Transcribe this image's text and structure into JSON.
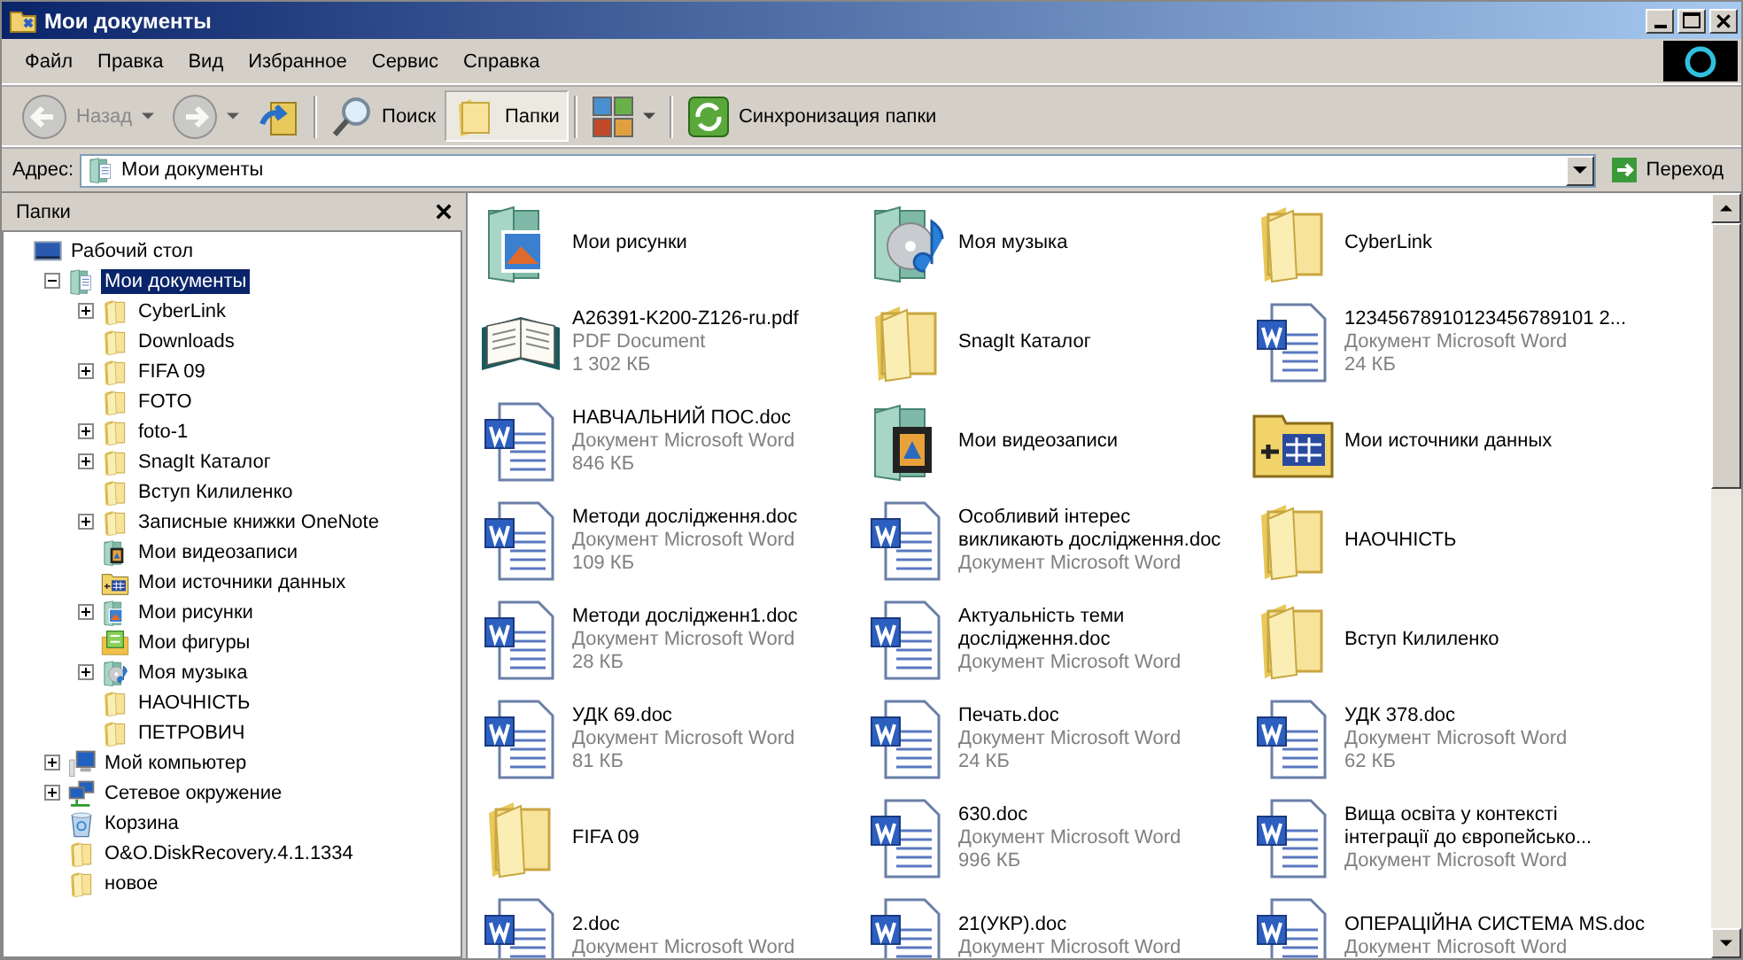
{
  "window": {
    "title": "Мои документы"
  },
  "menu": [
    "Файл",
    "Правка",
    "Вид",
    "Избранное",
    "Сервис",
    "Справка"
  ],
  "toolbar": [
    {
      "kind": "back",
      "label": "Назад",
      "disabled": true,
      "dropdown": true,
      "selected": false
    },
    {
      "kind": "forward",
      "disabled": true,
      "dropdown": true,
      "selected": false
    },
    {
      "kind": "up",
      "disabled": false,
      "dropdown": false,
      "selected": false
    },
    {
      "kind": "separator"
    },
    {
      "kind": "search",
      "label": "Поиск",
      "disabled": false,
      "dropdown": false,
      "selected": false
    },
    {
      "kind": "folders",
      "label": "Папки",
      "disabled": false,
      "dropdown": false,
      "selected": true
    },
    {
      "kind": "separator"
    },
    {
      "kind": "views",
      "disabled": false,
      "dropdown": true,
      "selected": false
    },
    {
      "kind": "separator"
    },
    {
      "kind": "sync",
      "label": "Синхронизация папки",
      "disabled": false,
      "dropdown": false,
      "selected": false
    }
  ],
  "address": {
    "label": "Адрес:",
    "value": "Мои документы",
    "go": "Переход"
  },
  "folders_pane": {
    "title": "Папки",
    "tree": [
      {
        "label": "Рабочий стол",
        "kind": "desktop",
        "selected": false,
        "children": [
          {
            "label": "Мои документы",
            "kind": "documents",
            "expanded": true,
            "selected": true,
            "children": [
              {
                "label": "CyberLink",
                "kind": "folder",
                "expanded": false,
                "selected": false
              },
              {
                "label": "Downloads",
                "kind": "folder",
                "selected": false
              },
              {
                "label": "FIFA 09",
                "kind": "folder",
                "expanded": false,
                "selected": false
              },
              {
                "label": "FOTO",
                "kind": "folder",
                "selected": false
              },
              {
                "label": "foto-1",
                "kind": "folder",
                "expanded": false,
                "selected": false
              },
              {
                "label": "SnagIt Каталог",
                "kind": "folder",
                "expanded": false,
                "selected": false
              },
              {
                "label": "Вступ Килиленко",
                "kind": "folder",
                "selected": false
              },
              {
                "label": "Записные книжки OneNote",
                "kind": "folder",
                "expanded": false,
                "selected": false
              },
              {
                "label": "Мои видеозаписи",
                "kind": "video",
                "selected": false
              },
              {
                "label": "Мои источники данных",
                "kind": "datasource",
                "selected": false
              },
              {
                "label": "Мои рисунки",
                "kind": "pictures",
                "expanded": false,
                "selected": false
              },
              {
                "label": "Мои фигуры",
                "kind": "shapes",
                "selected": false
              },
              {
                "label": "Моя музыка",
                "kind": "music",
                "expanded": false,
                "selected": false
              },
              {
                "label": "НАОЧНІСТЬ",
                "kind": "folder",
                "selected": false
              },
              {
                "label": "ПЕТРОВИЧ",
                "kind": "folder",
                "selected": false
              }
            ]
          },
          {
            "label": "Мой компьютер",
            "kind": "computer",
            "expanded": false,
            "selected": false
          },
          {
            "label": "Сетевое окружение",
            "kind": "network",
            "expanded": false,
            "selected": false
          },
          {
            "label": "Корзина",
            "kind": "recycle",
            "selected": false
          },
          {
            "label": "O&O.DiskRecovery.4.1.1334",
            "kind": "folder",
            "selected": false
          },
          {
            "label": "новое",
            "kind": "folder",
            "selected": false
          }
        ]
      }
    ]
  },
  "files": [
    {
      "kind": "pictures",
      "name": [
        "Мои рисунки"
      ]
    },
    {
      "kind": "music",
      "name": [
        "Моя музыка"
      ]
    },
    {
      "kind": "folder",
      "name": [
        "CyberLink"
      ]
    },
    {
      "kind": "book",
      "name": [
        "A26391-K200-Z126-ru.pdf"
      ],
      "type": "PDF Document",
      "size": "1 302 КБ"
    },
    {
      "kind": "folder",
      "name": [
        "SnagIt Каталог"
      ]
    },
    {
      "kind": "word",
      "name": [
        "12345678910123456789101 2..."
      ],
      "type": "Документ Microsoft Word",
      "size": "24 КБ"
    },
    {
      "kind": "word",
      "name": [
        "НАВЧАЛЬНИЙ ПОС.doc"
      ],
      "type": "Документ Microsoft Word",
      "size": "846 КБ"
    },
    {
      "kind": "video",
      "name": [
        "Мои видеозаписи"
      ]
    },
    {
      "kind": "datasource",
      "name": [
        "Мои источники данных"
      ]
    },
    {
      "kind": "word",
      "name": [
        "Методи дослідження.doc"
      ],
      "type": "Документ Microsoft Word",
      "size": "109 КБ"
    },
    {
      "kind": "word",
      "name": [
        "Особливий інтерес",
        "викликають дослідження.doc"
      ],
      "type": "Документ Microsoft Word"
    },
    {
      "kind": "folder",
      "name": [
        "НАОЧНІСТЬ"
      ]
    },
    {
      "kind": "word",
      "name": [
        "Методи дослідженн1.doc"
      ],
      "type": "Документ Microsoft Word",
      "size": "28 КБ"
    },
    {
      "kind": "word",
      "name": [
        "Актуальність теми",
        "дослідження.doc"
      ],
      "type": "Документ Microsoft Word"
    },
    {
      "kind": "folder",
      "name": [
        "Вступ Килиленко"
      ]
    },
    {
      "kind": "word",
      "name": [
        "УДК 69.doc"
      ],
      "type": "Документ Microsoft Word",
      "size": "81 КБ"
    },
    {
      "kind": "word",
      "name": [
        "Печать.doc"
      ],
      "type": "Документ Microsoft Word",
      "size": "24 КБ"
    },
    {
      "kind": "word",
      "name": [
        "УДК 378.doc"
      ],
      "type": "Документ Microsoft Word",
      "size": "62 КБ"
    },
    {
      "kind": "folder",
      "name": [
        "FIFA 09"
      ]
    },
    {
      "kind": "word",
      "name": [
        "630.doc"
      ],
      "type": "Документ Microsoft Word",
      "size": "996 КБ"
    },
    {
      "kind": "word",
      "name": [
        "Вища освіта у контексті",
        "інтеграції до європейсько..."
      ],
      "type": "Документ Microsoft Word"
    },
    {
      "kind": "word",
      "name": [
        "2.doc"
      ],
      "type": "Документ Microsoft Word"
    },
    {
      "kind": "word",
      "name": [
        "21(УКР).doc"
      ],
      "type": "Документ Microsoft Word"
    },
    {
      "kind": "word",
      "name": [
        "ОПЕРАЦІЙНА СИСТЕМА MS.doc"
      ],
      "type": "Документ Microsoft Word"
    }
  ]
}
